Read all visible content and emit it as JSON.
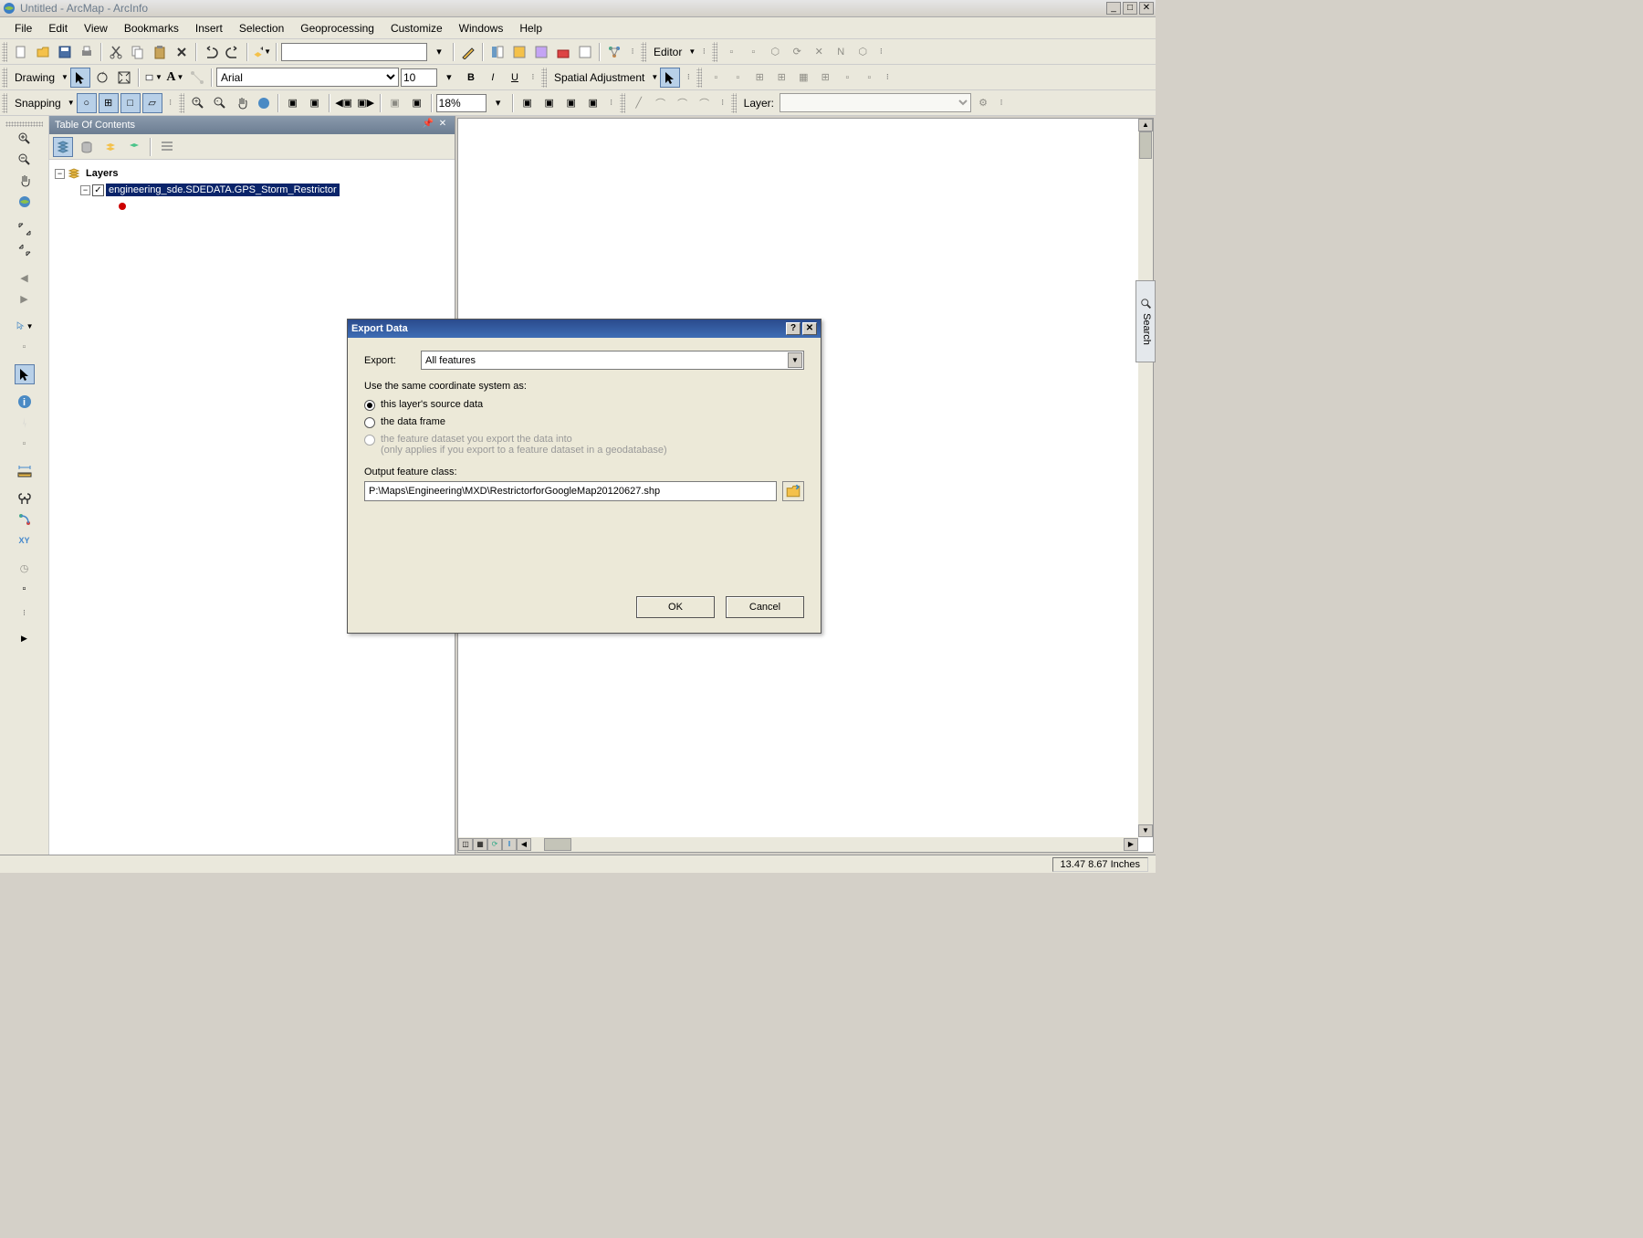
{
  "titlebar": {
    "title": "Untitled - ArcMap - ArcInfo"
  },
  "menus": [
    "File",
    "Edit",
    "View",
    "Bookmarks",
    "Insert",
    "Selection",
    "Geoprocessing",
    "Customize",
    "Windows",
    "Help"
  ],
  "toolbar1": {
    "font_select": "Arial",
    "font_size": "10",
    "drawing_label": "Drawing",
    "editor_label": "Editor",
    "spatial_adj_label": "Spatial Adjustment"
  },
  "toolbar2": {
    "snapping_label": "Snapping",
    "zoom_pct": "18%",
    "layer_label": "Layer:"
  },
  "toc": {
    "title": "Table Of Contents",
    "root": "Layers",
    "layer_name": "engineering_sde.SDEDATA.GPS_Storm_Restrictor"
  },
  "search_tab": "Search",
  "statusbar": {
    "coords": "13.47 8.67 Inches"
  },
  "dialog": {
    "title": "Export Data",
    "export_label": "Export:",
    "export_value": "All features",
    "coord_label": "Use the same coordinate system as:",
    "radio1": "this layer's source data",
    "radio2": "the data frame",
    "radio3a": "the feature dataset you export the data into",
    "radio3b": "(only applies if you export to a feature dataset in a geodatabase)",
    "output_label": "Output feature class:",
    "output_path": "P:\\Maps\\Engineering\\MXD\\RestrictorforGoogleMap20120627.shp",
    "ok": "OK",
    "cancel": "Cancel"
  }
}
